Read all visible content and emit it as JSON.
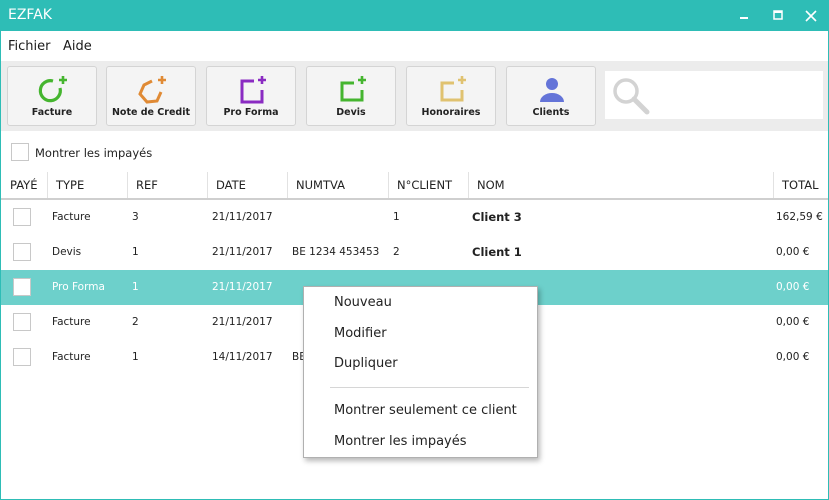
{
  "window": {
    "title": "EZFAK"
  },
  "menu": {
    "items": [
      "Fichier",
      "Aide"
    ]
  },
  "toolbar": {
    "buttons": [
      {
        "label": "Facture",
        "icon": "invoice-add-icon",
        "color": "#45b52f"
      },
      {
        "label": "Note de Credit",
        "icon": "credit-note-add-icon",
        "color": "#e08a34"
      },
      {
        "label": "Pro Forma",
        "icon": "pro-forma-add-icon",
        "color": "#8a2bc2"
      },
      {
        "label": "Devis",
        "icon": "quote-add-icon",
        "color": "#45b52f"
      },
      {
        "label": "Honoraires",
        "icon": "fees-add-icon",
        "color": "#e0c270"
      },
      {
        "label": "Clients",
        "icon": "clients-icon",
        "color": "#6474d8"
      }
    ],
    "search": {
      "placeholder": "",
      "value": ""
    }
  },
  "filter": {
    "show_unpaid_label": "Montrer les impayés",
    "checked": false
  },
  "table": {
    "columns": [
      "PAYÉ",
      "TYPE",
      "REF",
      "DATE",
      "NUMTVA",
      "N°CLIENT",
      "NOM",
      "TOTAL"
    ],
    "rows": [
      {
        "paid": false,
        "type": "Facture",
        "ref": "3",
        "date": "21/11/2017",
        "numtva": "",
        "client_no": "1",
        "name": "Client 3",
        "total": "162,59 €",
        "selected": false
      },
      {
        "paid": false,
        "type": "Devis",
        "ref": "1",
        "date": "21/11/2017",
        "numtva": "BE 1234 453453",
        "client_no": "2",
        "name": "Client 1",
        "total": "0,00 €",
        "selected": false
      },
      {
        "paid": false,
        "type": "Pro Forma",
        "ref": "1",
        "date": "21/11/2017",
        "numtva": "",
        "client_no": "",
        "name": "",
        "total": "0,00 €",
        "selected": true
      },
      {
        "paid": false,
        "type": "Facture",
        "ref": "2",
        "date": "21/11/2017",
        "numtva": "",
        "client_no": "",
        "name": "",
        "total": "0,00 €",
        "selected": false
      },
      {
        "paid": false,
        "type": "Facture",
        "ref": "1",
        "date": "14/11/2017",
        "numtva": "BE",
        "client_no": "",
        "name": "",
        "total": "0,00 €",
        "selected": false
      }
    ]
  },
  "context_menu": {
    "items": [
      "Nouveau",
      "Modifier",
      "Dupliquer",
      "Montrer seulement ce client",
      "Montrer les impayés"
    ]
  },
  "colors": {
    "accent": "#2ebdb6",
    "selection": "#6dd0cb"
  }
}
